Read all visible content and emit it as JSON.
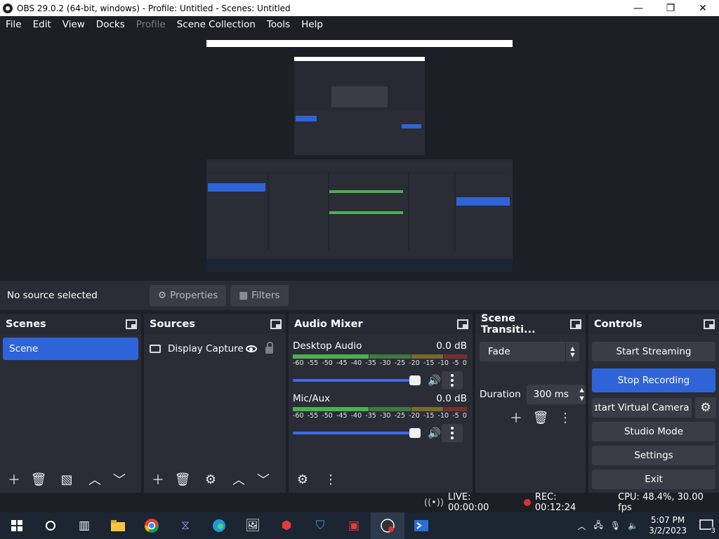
{
  "window": {
    "title": "OBS 29.0.2 (64-bit, windows) - Profile: Untitled - Scenes: Untitled",
    "minimize": "—",
    "maximize": "❐",
    "close": "✕"
  },
  "menu": [
    {
      "label": "File",
      "disabled": false
    },
    {
      "label": "Edit",
      "disabled": false
    },
    {
      "label": "View",
      "disabled": false
    },
    {
      "label": "Docks",
      "disabled": false
    },
    {
      "label": "Profile",
      "disabled": true
    },
    {
      "label": "Scene Collection",
      "disabled": false
    },
    {
      "label": "Tools",
      "disabled": false
    },
    {
      "label": "Help",
      "disabled": false
    }
  ],
  "source_toolbar": {
    "no_source": "No source selected",
    "properties": "Properties",
    "filters": "Filters"
  },
  "scenes": {
    "title": "Scenes",
    "items": [
      "Scene"
    ]
  },
  "sources": {
    "title": "Sources",
    "items": [
      {
        "name": "Display Capture",
        "icon": "monitor-icon"
      }
    ]
  },
  "mixer": {
    "title": "Audio Mixer",
    "scale": [
      "-60",
      "-55",
      "-50",
      "-45",
      "-40",
      "-35",
      "-30",
      "-25",
      "-20",
      "-15",
      "-10",
      "-5",
      "0"
    ],
    "channels": [
      {
        "name": "Desktop Audio",
        "level": "0.0 dB"
      },
      {
        "name": "Mic/Aux",
        "level": "0.0 dB"
      }
    ]
  },
  "transitions": {
    "title": "Scene Transiti...",
    "selected": "Fade",
    "duration_label": "Duration",
    "duration_value": "300 ms"
  },
  "controls": {
    "title": "Controls",
    "start_streaming": "Start Streaming",
    "stop_recording": "Stop Recording",
    "start_virtual_camera": "ɪtart Virtual Camera",
    "studio_mode": "Studio Mode",
    "settings": "Settings",
    "exit": "Exit"
  },
  "status": {
    "live": "LIVE: 00:00:00",
    "rec": "REC: 00:12:24",
    "cpu": "CPU: 48.4%, 30.00 fps"
  },
  "taskbar": {
    "time": "5:07 PM",
    "date": "3/2/2023",
    "notifications": "3"
  },
  "colors": {
    "accent": "#2f64d8",
    "panel": "#2a2d36",
    "background": "#1d1f26",
    "record": "#e03131"
  }
}
